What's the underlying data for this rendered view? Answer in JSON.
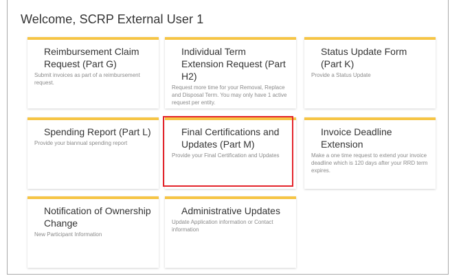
{
  "header": {
    "welcome": "Welcome, SCRP External User 1"
  },
  "cards": [
    {
      "title": "Reimbursement Claim Request (Part G)",
      "desc": "Submit invoices as part of a reimbursement request."
    },
    {
      "title": "Individual Term Extension Request (Part H2)",
      "desc": "Request more time for your Removal, Replace and Disposal Term. You may only have 1 active request per entity."
    },
    {
      "title": "Status Update Form (Part K)",
      "desc": "Provide a Status Update"
    },
    {
      "title": "Spending Report (Part L)",
      "desc": "Provide your biannual spending report"
    },
    {
      "title": "Final Certifications and Updates (Part M)",
      "desc": "Provide your Final Certification and Updates"
    },
    {
      "title": "Invoice Deadline Extension",
      "desc": "Make a one time request to extend your invoice deadline which is 120 days after your RRD term expires."
    },
    {
      "title": "Notification of Ownership Change",
      "desc": "New Participant Information"
    },
    {
      "title": "Administrative Updates",
      "desc": "Update Application information or Contact information"
    }
  ],
  "colors": {
    "card_accent": "#f6c545",
    "highlight": "#e3232a"
  }
}
